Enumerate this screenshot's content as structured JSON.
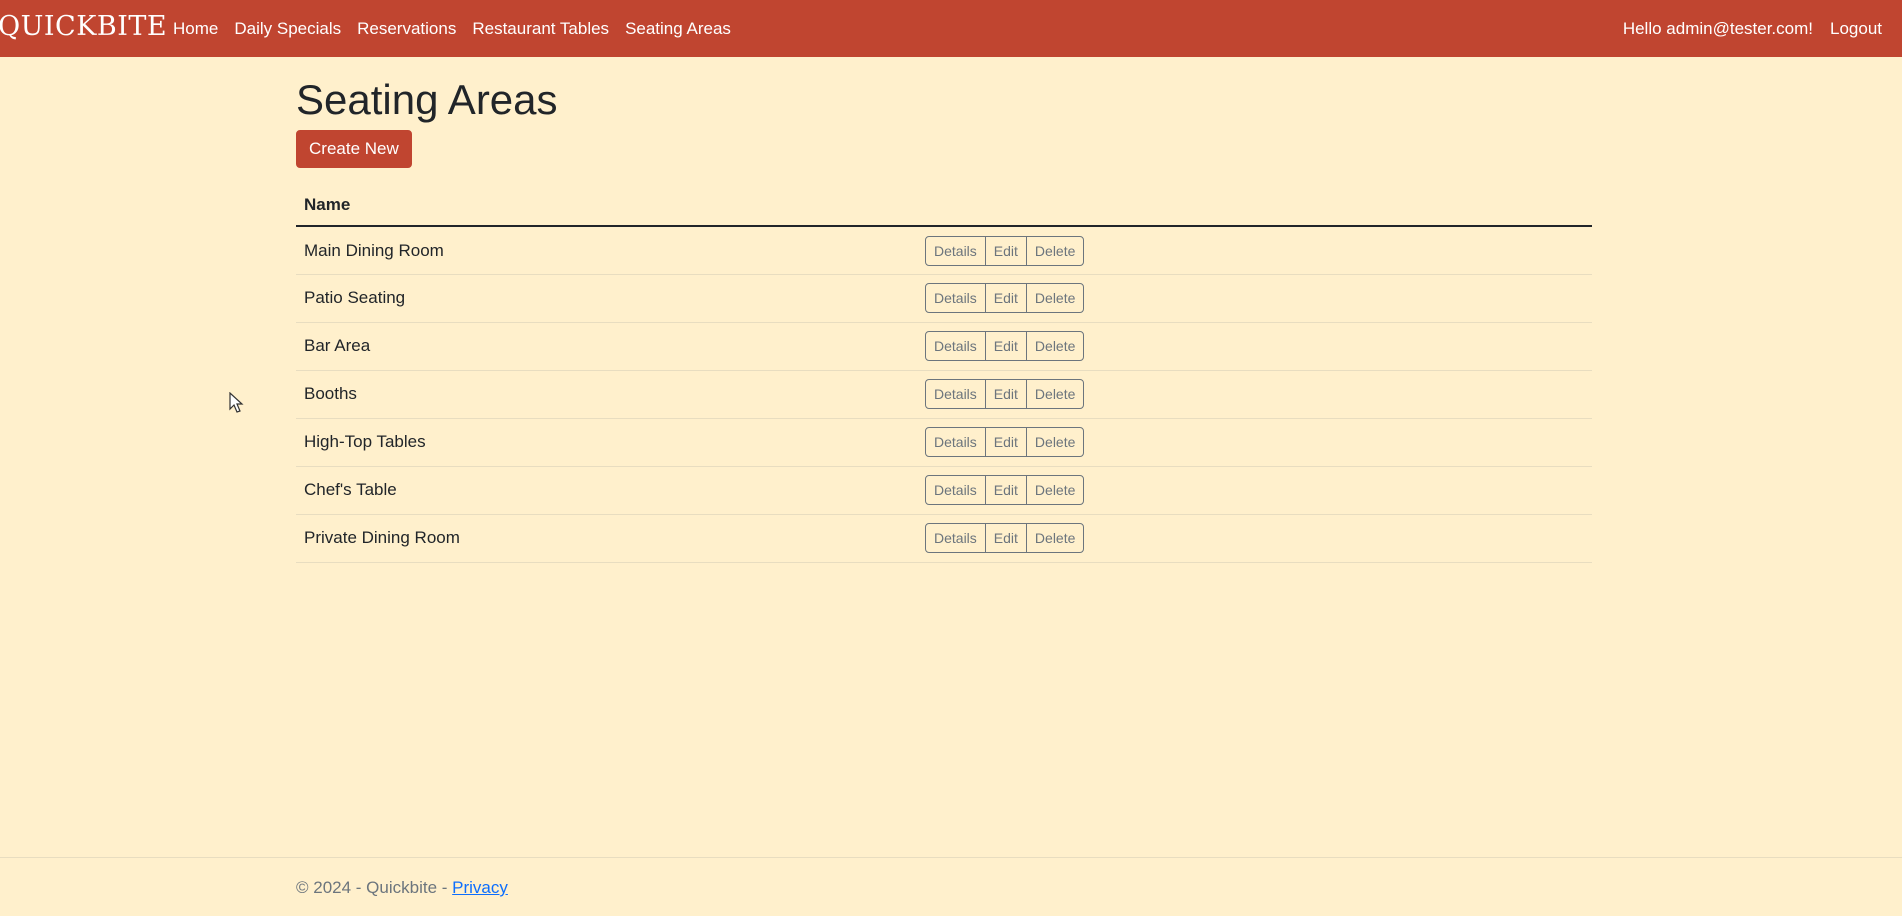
{
  "brand": "QUICKBITE",
  "nav": {
    "items": [
      "Home",
      "Daily Specials",
      "Reservations",
      "Restaurant Tables",
      "Seating Areas"
    ],
    "greeting": "Hello admin@tester.com!",
    "logout": "Logout"
  },
  "page": {
    "title": "Seating Areas",
    "create_label": "Create New"
  },
  "table": {
    "header_name": "Name",
    "rows": [
      "Main Dining Room",
      "Patio Seating",
      "Bar Area",
      "Booths",
      "High-Top Tables",
      "Chef's Table",
      "Private Dining Room"
    ],
    "actions": {
      "details": "Details",
      "edit": "Edit",
      "delete": "Delete"
    }
  },
  "footer": {
    "text": "© 2024 - Quickbite - ",
    "privacy": "Privacy"
  },
  "colors": {
    "navbar": "#c04530",
    "background": "#fff0cc",
    "primary_button": "#c04530"
  }
}
